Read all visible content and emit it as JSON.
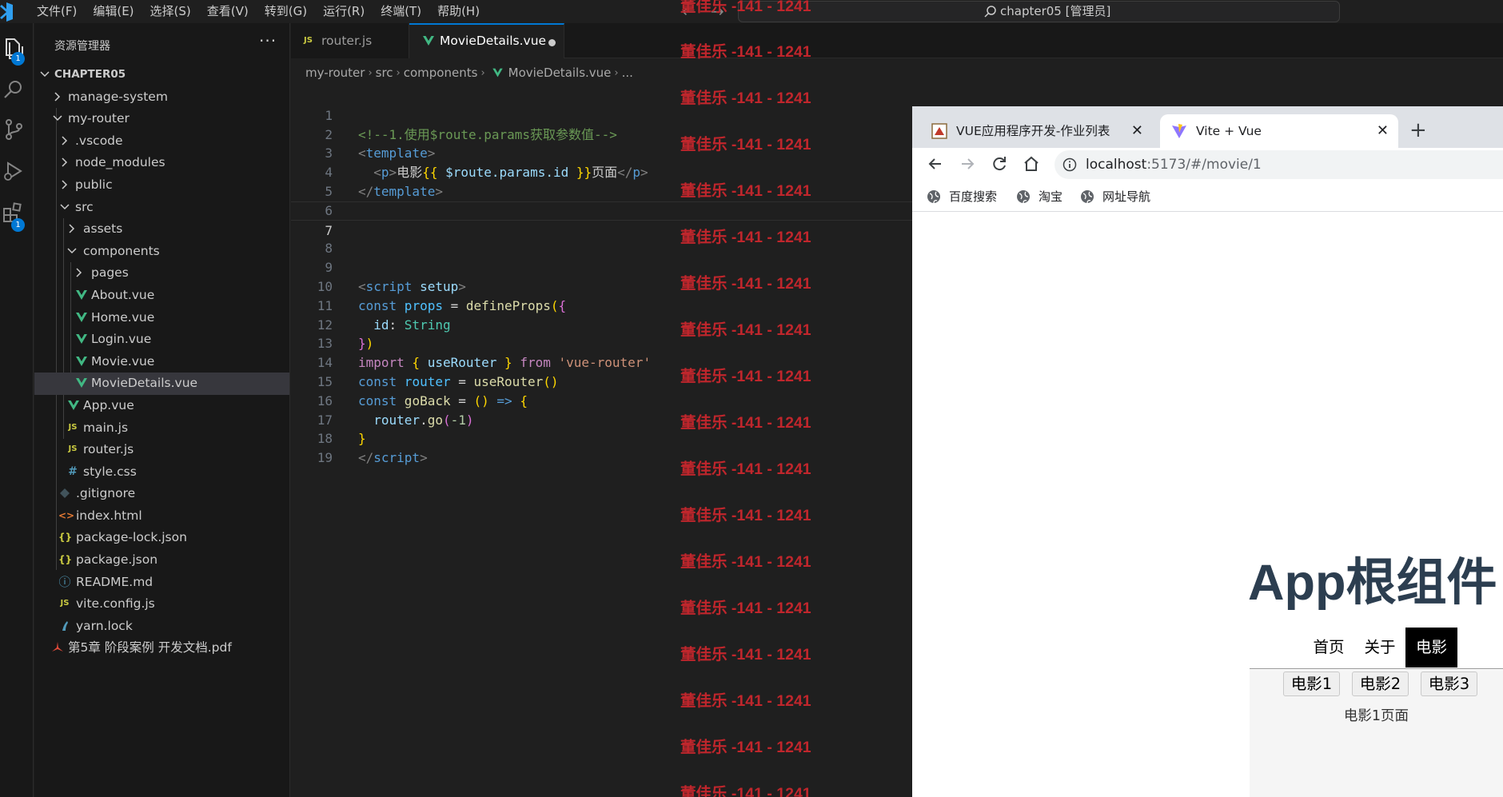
{
  "titlebar": {
    "menu": [
      "文件(F)",
      "编辑(E)",
      "选择(S)",
      "查看(V)",
      "转到(G)",
      "运行(R)",
      "终端(T)",
      "帮助(H)"
    ],
    "command_center": "chapter05 [管理员]"
  },
  "activitybar": {
    "explorer_badge": "1",
    "extensions_badge": "1"
  },
  "sidebar": {
    "title": "资源管理器",
    "more": "···",
    "tree": [
      "CHAPTER05",
      "manage-system",
      "my-router",
      ".vscode",
      "node_modules",
      "public",
      "src",
      "assets",
      "components",
      "pages",
      "About.vue",
      "Home.vue",
      "Login.vue",
      "Movie.vue",
      "MovieDetails.vue",
      "App.vue",
      "main.js",
      "router.js",
      "style.css",
      ".gitignore",
      "index.html",
      "package-lock.json",
      "package.json",
      "README.md",
      "vite.config.js",
      "yarn.lock",
      "第5章 阶段案例 开发文档.pdf"
    ],
    "icons": {
      "js": "JS",
      "css": "#",
      "json": "{}",
      "html": "<>",
      "info": "ⓘ"
    }
  },
  "editor": {
    "tabs": [
      {
        "label": "router.js",
        "icon": "JS"
      },
      {
        "label": "MovieDetails.vue"
      }
    ],
    "breadcrumb": [
      "my-router",
      "src",
      "components",
      "MovieDetails.vue",
      "..."
    ],
    "line_numbers": [
      "1",
      "2",
      "3",
      "4",
      "5",
      "6",
      "7",
      "8",
      "9",
      "10",
      "11",
      "12",
      "13",
      "14",
      "15",
      "16",
      "17",
      "18",
      "19"
    ],
    "active_line": "7",
    "code": {
      "l1": "<!--1.使用$route.params获取参数值-->",
      "l2_open": "<",
      "l2_tag": "template",
      "l2_close": ">",
      "l3_indent": "  ",
      "l3_open": "<",
      "l3_tag": "p",
      "l3_close": ">",
      "l3_text": "电影",
      "l3_mopen": "{{",
      "l3_expr": " $route.params.id ",
      "l3_mclose": "}}",
      "l3_text2": "页面",
      "l3_eopen": "</",
      "l3_etag": "p",
      "l3_eclose": ">",
      "l4_open": "</",
      "l4_tag": "template",
      "l4_close": ">",
      "l9_open": "<",
      "l9_tag": "script",
      "l9_attr": " setup",
      "l9_close": ">",
      "l10_kw": "const",
      "l10_var": " props",
      "l10_eq": " = ",
      "l10_fn": "defineProps",
      "l10_p": "(",
      "l10_b": "{",
      "l11_key": "  id",
      "l11_colon": ": ",
      "l11_type": "String",
      "l12_b": "}",
      "l12_p": ")",
      "l13_kw": "import",
      "l13_b1": " { ",
      "l13_var": "useRouter",
      "l13_b2": " } ",
      "l13_from": "from",
      "l13_str": " 'vue-router'",
      "l14_kw": "const",
      "l14_var": " router",
      "l14_eq": " = ",
      "l14_fn": "useRouter",
      "l14_p": "()",
      "l15_kw": "const",
      "l15_var": " goBack",
      "l15_eq": " = ",
      "l15_p": "()",
      "l15_arrow": " => ",
      "l15_b": "{",
      "l16_var": "  router",
      "l16_dot": ".",
      "l16_fn": "go",
      "l16_p1": "(",
      "l16_num": "-1",
      "l16_p2": ")",
      "l17_b": "}",
      "l18_open": "</",
      "l18_tag": "script",
      "l18_close": ">"
    }
  },
  "watermark": "董佳乐 -141 - 1241",
  "browser": {
    "tabs": [
      {
        "title": "VUE应用程序开发-作业列表",
        "close": "✕"
      },
      {
        "title": "Vite + Vue",
        "close": "✕"
      }
    ],
    "new_tab": "+",
    "url_host": "localhost",
    "url_path": ":5173/#/movie/1",
    "bookmarks": [
      "百度搜索",
      "淘宝",
      "网址导航"
    ],
    "page": {
      "title": "App根组件",
      "nav": [
        "首页",
        "关于",
        "电影"
      ],
      "movie_buttons": [
        "电影1",
        "电影2",
        "电影3"
      ],
      "movie_text": "电影1页面"
    }
  },
  "colors": {
    "watermark": "#c0262c",
    "accent": "#0078d4",
    "vue_green": "#41b883"
  }
}
